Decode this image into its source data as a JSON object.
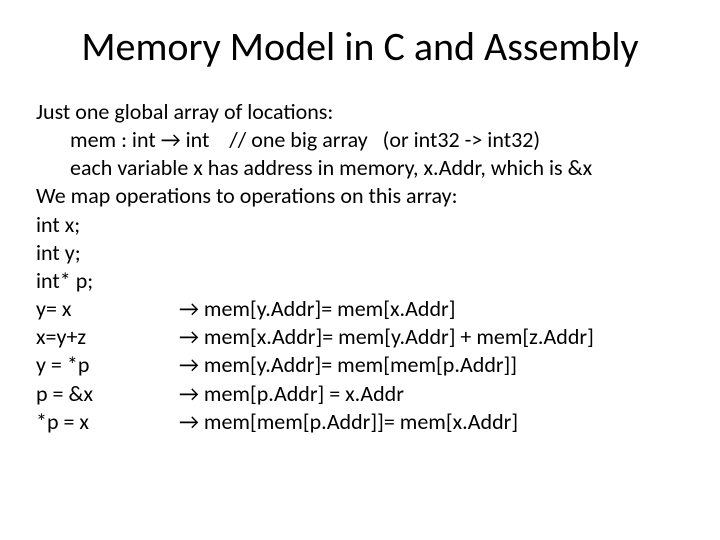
{
  "title": "Memory Model in C and Assembly",
  "intro": {
    "l1": "Just one global array of locations:",
    "l2_pre": "mem : int ",
    "l2_arrow": "→",
    "l2_post": " int    // one big array   (or int32 -> int32)",
    "l3": "each variable x has address in memory, x.Addr, which is &x",
    "l4": "We map operations to operations on this array:"
  },
  "decls": {
    "d1": "int x;",
    "d2": "int y;",
    "d3": "int* p;"
  },
  "arrow": "→",
  "maps": [
    {
      "left": "y= x",
      "right": " mem[y.Addr]= mem[x.Addr]"
    },
    {
      "left": "x=y+z",
      "right": " mem[x.Addr]= mem[y.Addr] + mem[z.Addr]"
    },
    {
      "left": "y = *p",
      "right": " mem[y.Addr]= mem[mem[p.Addr]]"
    },
    {
      "left": "p = &x",
      "right": " mem[p.Addr] = x.Addr"
    },
    {
      "left": "*p = x",
      "right": " mem[mem[p.Addr]]= mem[x.Addr]"
    }
  ]
}
